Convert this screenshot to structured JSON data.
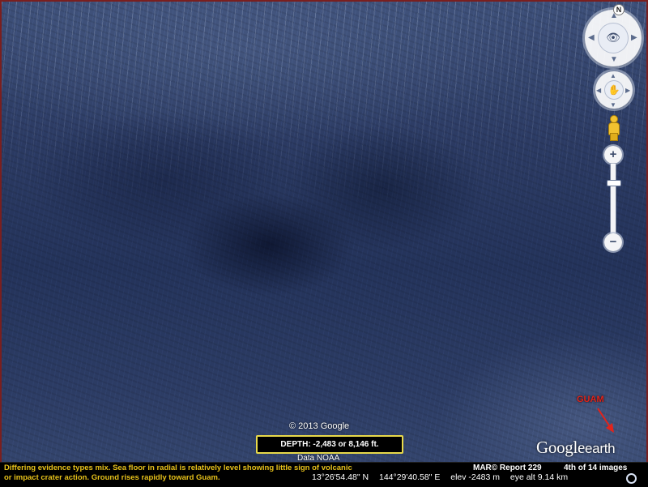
{
  "map": {
    "copyright": "© 2013 Google",
    "depth_label": "DEPTH: -2,483 or 8,146 ft.",
    "data_credit": "Data NOAA",
    "guam_label": "GUAM",
    "logo_google": "Google",
    "logo_earth": "earth"
  },
  "controls": {
    "north_label": "N",
    "zoom_in": "+",
    "zoom_out": "−",
    "zoom_level_fraction": 0.75
  },
  "caption": {
    "line1": "Differing evidence types mix.  Sea floor in radial is relatively level showing little sign of volcanic",
    "line2": "or impact crater action.  Ground rises rapidly toward Guam.",
    "report": "MAR© Report 229",
    "count": "4th of 14 images"
  },
  "status": {
    "lat": "13°26'54.48\" N",
    "lon": "144°29'40.58\" E",
    "elev": "elev -2483 m",
    "eye_alt": "eye alt   9.14 km"
  },
  "colors": {
    "caption_text": "#e8c21a",
    "depth_border": "#e8d94a",
    "guam_red": "#e0241b"
  }
}
